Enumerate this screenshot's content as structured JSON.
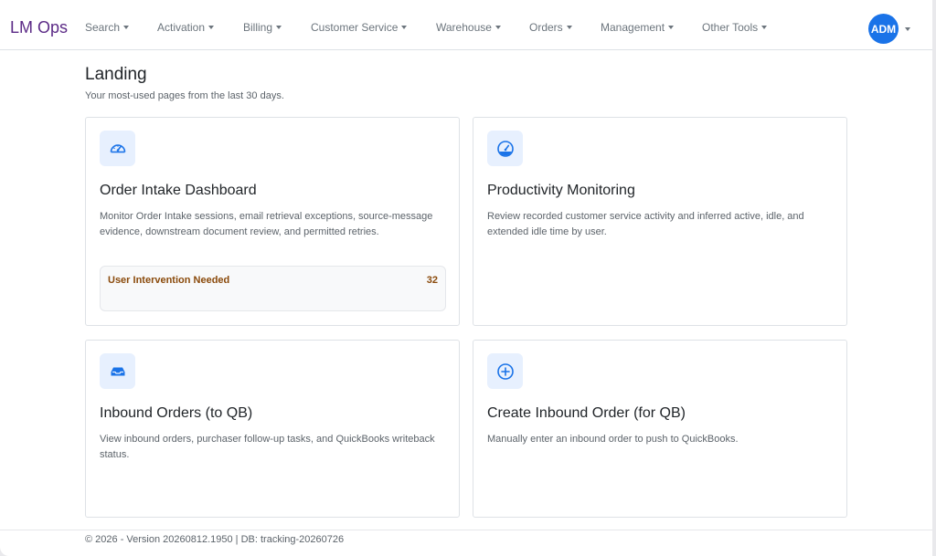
{
  "brand": "LM Ops",
  "nav": [
    {
      "label": "Search"
    },
    {
      "label": "Activation"
    },
    {
      "label": "Billing"
    },
    {
      "label": "Customer Service"
    },
    {
      "label": "Warehouse"
    },
    {
      "label": "Orders"
    },
    {
      "label": "Management"
    },
    {
      "label": "Other Tools"
    }
  ],
  "user": {
    "initials": "ADM"
  },
  "page": {
    "title": "Landing",
    "subtitle": "Your most-used pages from the last 30 days."
  },
  "cards": [
    {
      "icon": "speedometer-icon",
      "title": "Order Intake Dashboard",
      "description": "Monitor Order Intake sessions, email retrieval exceptions, source-message evidence, downstream document review, and permitted retries.",
      "alert": {
        "label": "User Intervention Needed",
        "count": "32"
      }
    },
    {
      "icon": "speedometer-filled-icon",
      "title": "Productivity Monitoring",
      "description": "Review recorded customer service activity and inferred active, idle, and extended idle time by user."
    },
    {
      "icon": "inbox-icon",
      "title": "Inbound Orders (to QB)",
      "description": "View inbound orders, purchaser follow-up tasks, and QuickBooks writeback status."
    },
    {
      "icon": "plus-circle-icon",
      "title": "Create Inbound Order (for QB)",
      "description": "Manually enter an inbound order to push to QuickBooks."
    }
  ],
  "footer": "© 2026 - Version 20260812.1950 | DB: tracking-20260726",
  "colors": {
    "brand": "#5b2a86",
    "accent": "#1a73e8",
    "icon_bg": "#e7f0fe",
    "alert_text": "#8a4a0b"
  }
}
